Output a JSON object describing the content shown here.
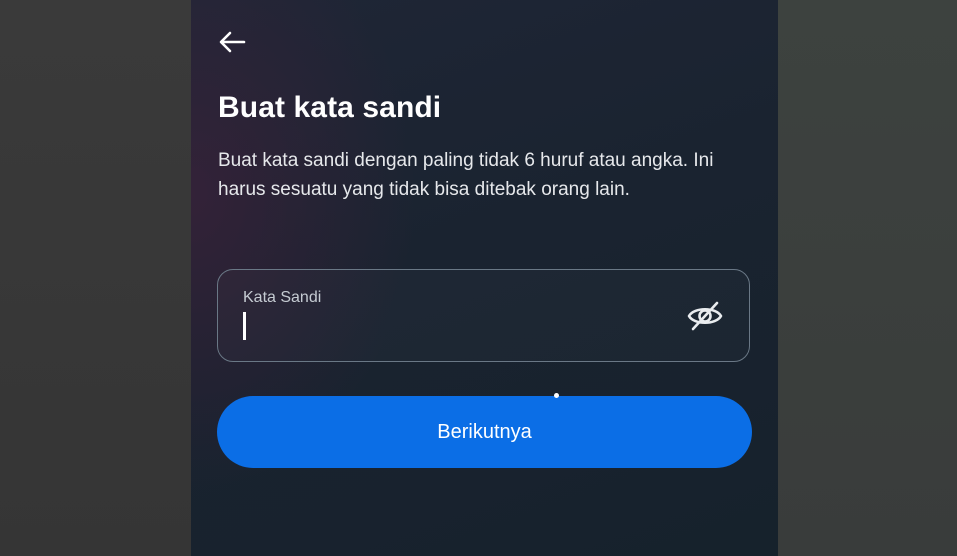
{
  "screen": {
    "title": "Buat kata sandi",
    "description": "Buat kata sandi dengan paling tidak 6 huruf atau angka. Ini harus sesuatu yang tidak bisa ditebak orang lain.",
    "icons": {
      "back": "arrow-left-icon",
      "visibility": "eye-slash-icon"
    }
  },
  "password_field": {
    "label": "Kata Sandi",
    "value": ""
  },
  "next_button": {
    "label": "Berikutnya"
  },
  "colors": {
    "accent": "#0b6ee6",
    "background": "#1b2431",
    "text": "#ffffff",
    "field_border": "#6a7886"
  }
}
